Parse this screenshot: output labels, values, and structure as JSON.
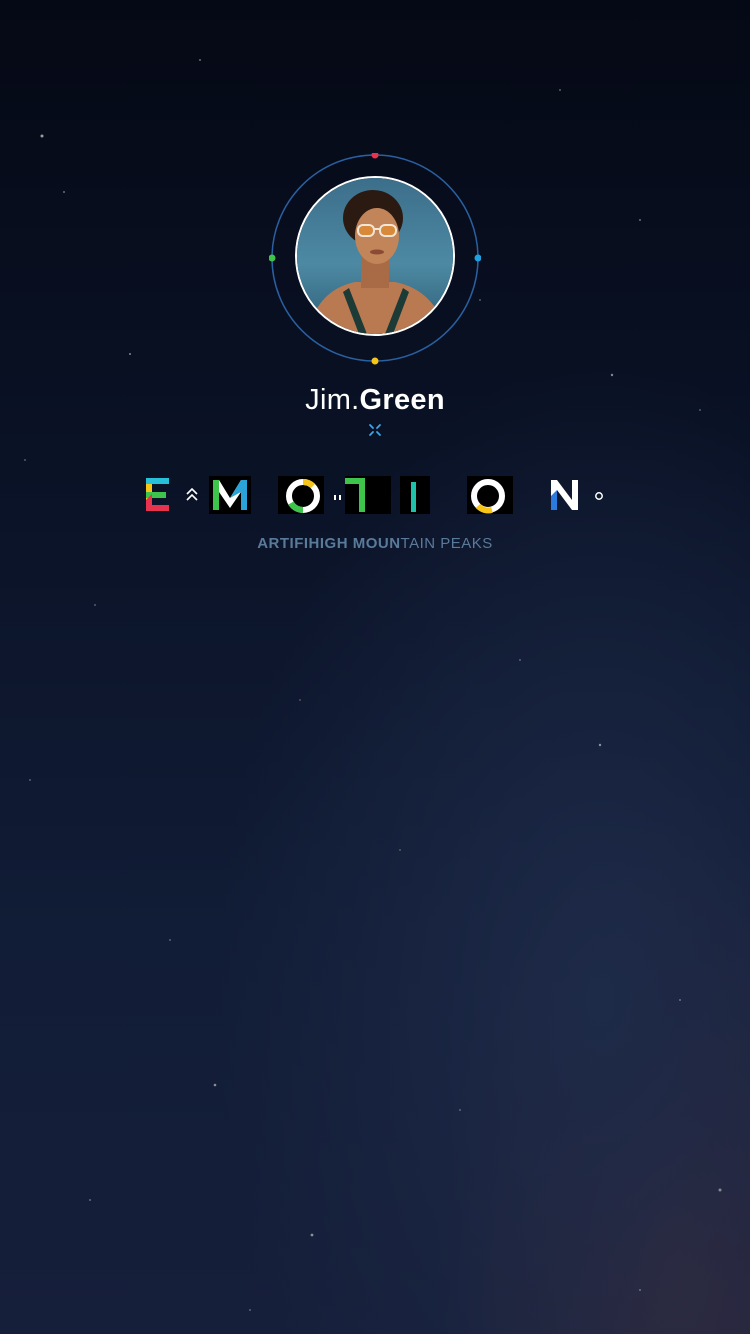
{
  "profile": {
    "first_name": "Jim.",
    "last_name": "Green"
  },
  "logo": {
    "word": "EMOTION"
  },
  "tagline": {
    "bold_part": "ARTIFIHIGH MOUN",
    "light_part": "TAIN PEAKS"
  },
  "colors": {
    "ring": "#2a5fa0",
    "dot_top": "#e8334f",
    "dot_right": "#1ea1e0",
    "dot_bottom": "#f5c518",
    "dot_left": "#3ec44a",
    "tagline": "#5a7a9a"
  }
}
